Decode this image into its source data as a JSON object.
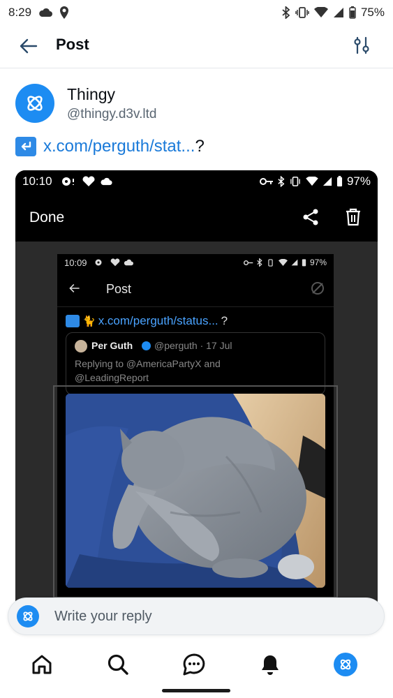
{
  "status_bar": {
    "time": "8:29",
    "battery": "75%"
  },
  "header": {
    "title": "Post"
  },
  "post": {
    "author_name": "Thingy",
    "author_handle": "@thingy.d3v.ltd",
    "link_text": "x.com/perguth/stat...",
    "text_tail": "?"
  },
  "embed": {
    "status_time": "10:10",
    "status_battery": "97%",
    "done_label": "Done",
    "inner": {
      "status_time": "10:09",
      "status_battery": "97%",
      "title": "Post",
      "link_text": "x.com/perguth/status...",
      "link_tail": "?",
      "quote_name": "Per Guth",
      "quote_handle": "@perguth · 17 Jul",
      "quote_reply": "Replying to @AmericaPartyX and @LeadingReport"
    }
  },
  "reply": {
    "placeholder": "Write your reply"
  },
  "nav": [
    "home",
    "search",
    "chat",
    "notifications",
    "profile"
  ],
  "colors": {
    "accent": "#1d8cf2",
    "link": "#1a7ad9",
    "embed_bg": "#2b2b2b"
  }
}
